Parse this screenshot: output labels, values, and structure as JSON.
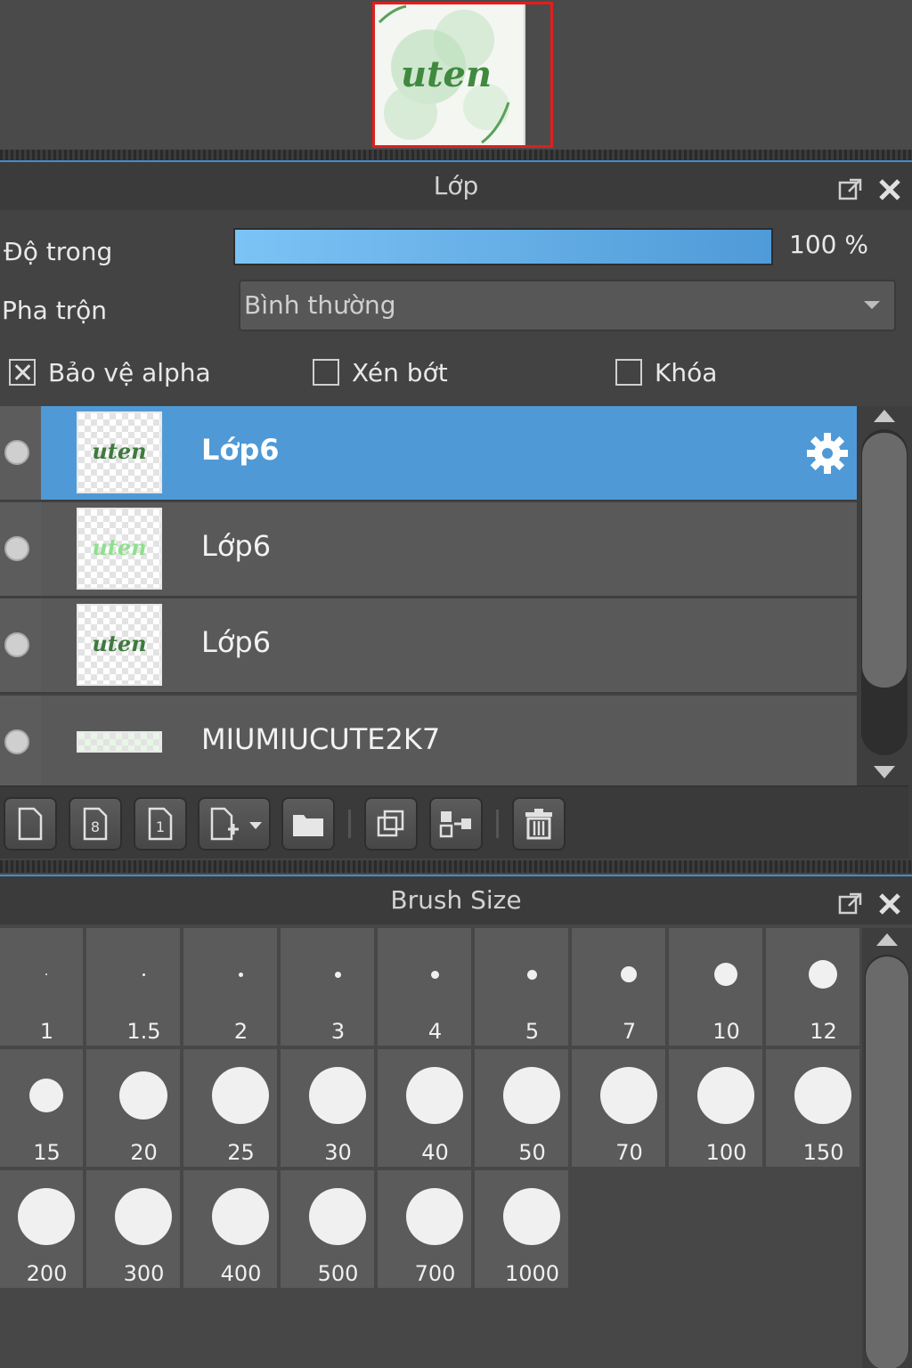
{
  "navigator": {
    "thumbnail_text": "uten"
  },
  "layer_panel": {
    "title": "Lớp",
    "opacity_label": "Độ trong",
    "opacity_value": "100 %",
    "opacity_fraction": 1.0,
    "blend_label": "Pha trộn",
    "blend_value": "Bình thường",
    "checks": [
      {
        "label": "Bảo vệ alpha",
        "checked": true
      },
      {
        "label": "Xén bớt",
        "checked": false
      },
      {
        "label": "Khóa",
        "checked": false
      }
    ],
    "layers": [
      {
        "name": "Lớp6",
        "selected": true,
        "thumb_text": "uten",
        "thumb_color": "#3e7a3e"
      },
      {
        "name": "Lớp6",
        "selected": false,
        "thumb_text": "uten",
        "thumb_color": "#8ee08e"
      },
      {
        "name": "Lớp6",
        "selected": false,
        "thumb_text": "uten",
        "thumb_color": "#3e7a3e"
      },
      {
        "name": "MIUMIUCUTE2K7",
        "selected": false,
        "thumb_text": "",
        "thumb_color": "#b6e6b6"
      }
    ],
    "toolbar_icons": [
      "new-layer-icon",
      "new-8bit-layer-icon",
      "new-1bit-layer-icon",
      "add-layer-menu-icon",
      "new-folder-icon",
      "duplicate-layer-icon",
      "merge-down-icon",
      "delete-layer-icon"
    ]
  },
  "brush_panel": {
    "title": "Brush Size",
    "sizes": [
      "1",
      "1.5",
      "2",
      "3",
      "4",
      "5",
      "7",
      "10",
      "12",
      "15",
      "20",
      "25",
      "30",
      "40",
      "50",
      "70",
      "100",
      "150",
      "200",
      "300",
      "400",
      "500",
      "700",
      "1000"
    ]
  },
  "colors": {
    "accent": "#4f9ad6",
    "navigator_border": "#e21e1e"
  }
}
